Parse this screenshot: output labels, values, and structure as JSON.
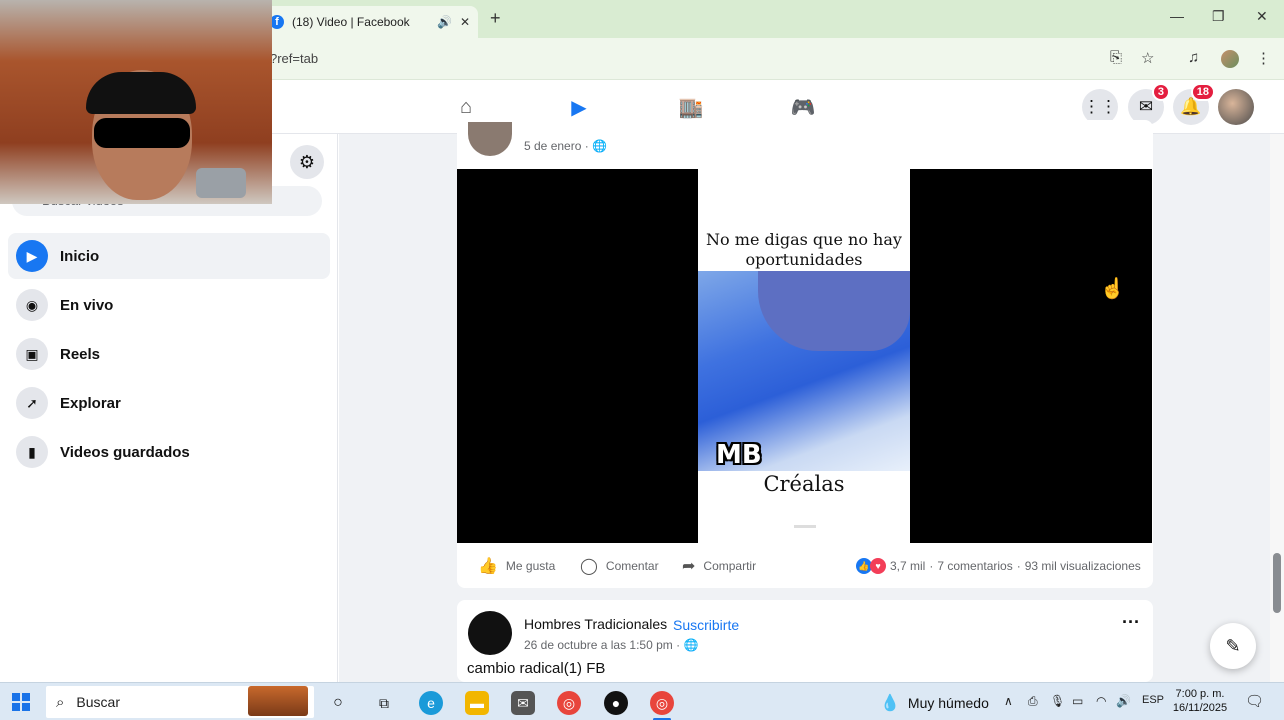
{
  "browser": {
    "tab_title": "(18) Video | Facebook",
    "url_fragment": "?ref=tab"
  },
  "nav": {
    "messenger_badge": "3",
    "notifications_badge": "18"
  },
  "sidebar": {
    "search_placeholder": "Buscar videos",
    "items": [
      {
        "label": "Inicio",
        "icon": "play-icon"
      },
      {
        "label": "En vivo",
        "icon": "live-camera-icon"
      },
      {
        "label": "Reels",
        "icon": "reels-icon"
      },
      {
        "label": "Explorar",
        "icon": "rocket-icon"
      },
      {
        "label": "Videos guardados",
        "icon": "bookmark-icon"
      }
    ]
  },
  "post1": {
    "date": "5 de enero ·",
    "video_caption_top": "No me digas que no hay oportunidades",
    "video_watermark": "MB",
    "video_caption_bottom": "Créalas",
    "like_label": "Me gusta",
    "comment_label": "Comentar",
    "share_label": "Compartir",
    "reactions_count": "3,7 mil",
    "comments_count": "7 comentarios",
    "views_count": "93 mil visualizaciones"
  },
  "post2": {
    "page_name": "Hombres Tradicionales",
    "subscribe_label": "Suscribirte",
    "date": "26 de octubre a las 1:50 pm ·",
    "text": "cambio radical(1) FB"
  },
  "taskbar": {
    "search_label": "Buscar",
    "weather": "Muy húmedo",
    "language": "ESP",
    "time": "7:00 p. m.",
    "date": "16/11/2025"
  },
  "colors": {
    "fb_blue": "#1877f2",
    "badge_red": "#e41e3f",
    "chrome_frame": "#d9ecd2"
  }
}
